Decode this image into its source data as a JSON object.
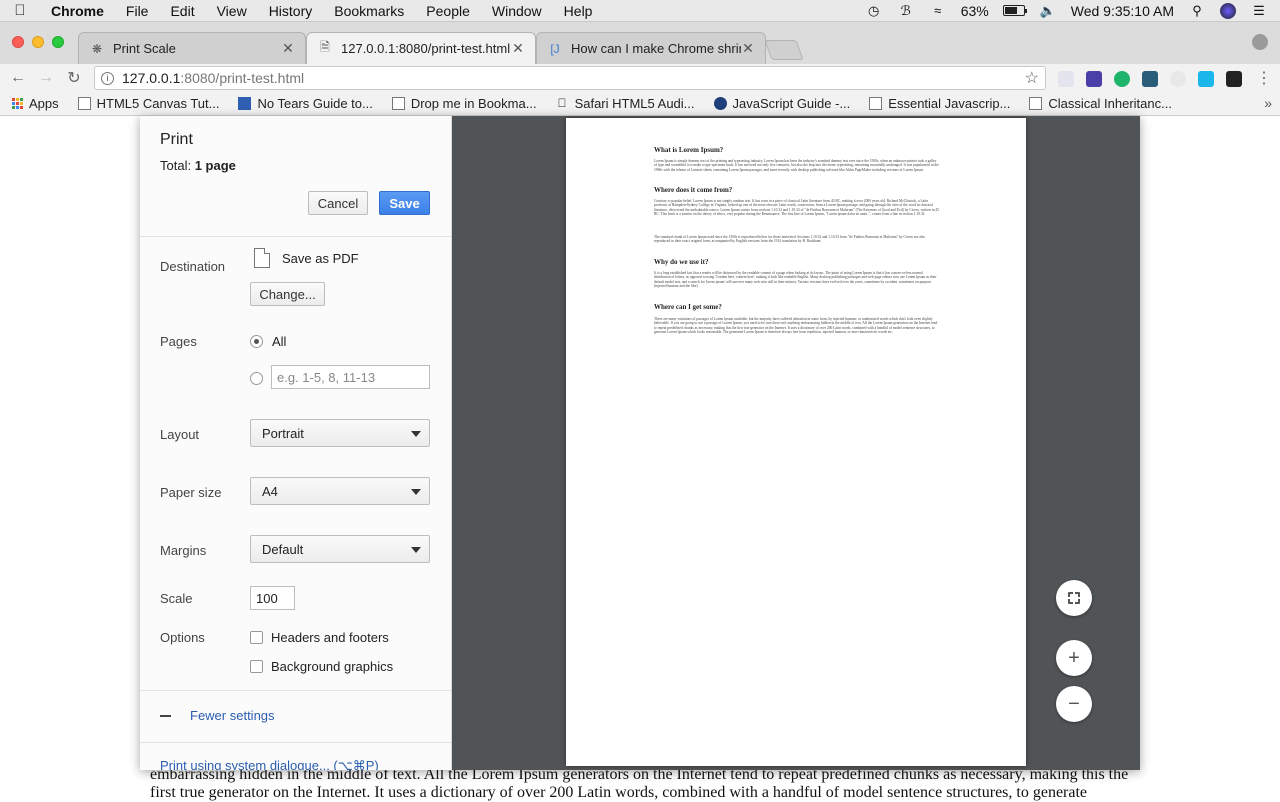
{
  "menubar": {
    "app": "Chrome",
    "items": [
      "File",
      "Edit",
      "View",
      "History",
      "Bookmarks",
      "People",
      "Window",
      "Help"
    ],
    "battery_percent": "63%",
    "battery_level": 0.63,
    "clock": "Wed 9:35:10 AM"
  },
  "tabs": [
    {
      "title": "Print Scale",
      "icon": "chrome-icon",
      "active": false
    },
    {
      "title": "127.0.0.1:8080/print-test.html",
      "icon": "page-icon",
      "active": true
    },
    {
      "title": "How can I make Chrome shrink",
      "icon": "stackoverflow-icon",
      "active": false
    }
  ],
  "toolbar": {
    "url_host": "127.0.0.1",
    "url_rest": ":8080/print-test.html"
  },
  "bookmarks": [
    {
      "label": "Apps",
      "icon": "apps-grid-icon"
    },
    {
      "label": "HTML5 Canvas Tut...",
      "icon": "page-icon"
    },
    {
      "label": "No Tears Guide to...",
      "icon": "html5-icon"
    },
    {
      "label": "Drop me in Bookma...",
      "icon": "page-icon"
    },
    {
      "label": "Safari HTML5 Audi...",
      "icon": "apple-icon"
    },
    {
      "label": "JavaScript Guide -...",
      "icon": "mdn-icon"
    },
    {
      "label": "Essential Javascrip...",
      "icon": "page-icon"
    },
    {
      "label": "Classical Inheritanc...",
      "icon": "page-icon"
    }
  ],
  "print": {
    "title": "Print",
    "total_prefix": "Total: ",
    "total_value": "1 page",
    "cancel": "Cancel",
    "save": "Save",
    "destination_label": "Destination",
    "destination_value": "Save as PDF",
    "change": "Change...",
    "pages_label": "Pages",
    "pages_all": "All",
    "pages_placeholder": "e.g. 1-5, 8, 11-13",
    "layout_label": "Layout",
    "layout_value": "Portrait",
    "paper_label": "Paper size",
    "paper_value": "A4",
    "margins_label": "Margins",
    "margins_value": "Default",
    "scale_label": "Scale",
    "scale_value": "100",
    "options_label": "Options",
    "headers_footers": "Headers and footers",
    "background_graphics": "Background graphics",
    "fewer_settings": "Fewer settings",
    "system_dialog": "Print using system dialogue... (⌥⌘P)"
  },
  "preview_page": {
    "h1": "What is Lorem Ipsum?",
    "p1": "Lorem Ipsum is simply dummy text of the printing and typesetting industry. Lorem Ipsum has been the industry's standard dummy text ever since the 1500s, when an unknown printer took a galley of type and scrambled it to make a type specimen book. It has survived not only five centuries, but also the leap into electronic typesetting, remaining essentially unchanged. It was popularised in the 1960s with the release of Letraset sheets containing Lorem Ipsum passages, and more recently with desktop publishing software like Aldus PageMaker including versions of Lorem Ipsum.",
    "h2": "Where does it come from?",
    "p2": "Contrary to popular belief, Lorem Ipsum is not simply random text. It has roots in a piece of classical Latin literature from 45 BC, making it over 2000 years old. Richard McClintock, a Latin professor at Hampden-Sydney College in Virginia, looked up one of the more obscure Latin words, consectetur, from a Lorem Ipsum passage, and going through the cites of the word in classical literature, discovered the undoubtable source. Lorem Ipsum comes from sections 1.10.32 and 1.10.33 of \"de Finibus Bonorum et Malorum\" (The Extremes of Good and Evil) by Cicero, written in 45 BC. This book is a treatise on the theory of ethics, very popular during the Renaissance. The first line of Lorem Ipsum, \"Lorem ipsum dolor sit amet..\", comes from a line in section 1.10.32.",
    "p3": "The standard chunk of Lorem Ipsum used since the 1500s is reproduced below for those interested. Sections 1.10.32 and 1.10.33 from \"de Finibus Bonorum et Malorum\" by Cicero are also reproduced in their exact original form, accompanied by English versions from the 1914 translation by H. Rackham.",
    "h3": "Why do we use it?",
    "p4": "It is a long established fact that a reader will be distracted by the readable content of a page when looking at its layout. The point of using Lorem Ipsum is that it has a more-or-less normal distribution of letters, as opposed to using 'Content here, content here', making it look like readable English. Many desktop publishing packages and web page editors now use Lorem Ipsum as their default model text, and a search for 'lorem ipsum' will uncover many web sites still in their infancy. Various versions have evolved over the years, sometimes by accident, sometimes on purpose (injected humour and the like).",
    "h4": "Where can I get some?",
    "p5": "There are many variations of passages of Lorem Ipsum available, but the majority have suffered alteration in some form, by injected humour, or randomised words which don't look even slightly believable. If you are going to use a passage of Lorem Ipsum, you need to be sure there isn't anything embarrassing hidden in the middle of text. All the Lorem Ipsum generators on the Internet tend to repeat predefined chunks as necessary, making this the first true generator on the Internet. It uses a dictionary of over 200 Latin words, combined with a handful of model sentence structures, to generate Lorem Ipsum which looks reasonable. The generated Lorem Ipsum is therefore always free from repetition, injected humour, or non-characteristic words etc."
  },
  "behind_page": {
    "line1": "embarrassing hidden in the middle of text. All the Lorem Ipsum generators on the Internet tend to repeat predefined chunks as necessary, making this the",
    "line2": "first true generator on the Internet. It uses a dictionary of over 200 Latin words, combined with a handful of model sentence structures, to generate"
  }
}
